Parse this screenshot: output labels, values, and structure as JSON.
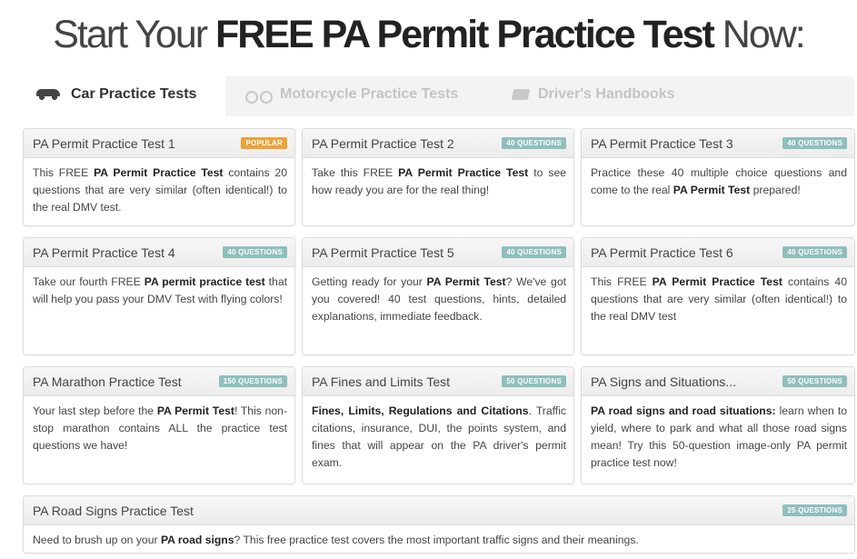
{
  "headline": {
    "prefix": "Start Your ",
    "emphasis": "FREE PA Permit Practice Test",
    "suffix": " Now:"
  },
  "tabs": [
    {
      "label": "Car Practice Tests",
      "icon": "car-icon",
      "active": true
    },
    {
      "label": "Motorcycle Practice Tests",
      "icon": "motorcycle-icon",
      "active": false
    },
    {
      "label": "Driver's Handbooks",
      "icon": "book-icon",
      "active": false
    }
  ],
  "colors": {
    "popular_badge": "#f0a23a",
    "questions_badge": "#8fbfbc"
  },
  "cards": [
    {
      "title": "PA Permit Practice Test 1",
      "badge": "POPULAR",
      "body": [
        {
          "t": "This FREE "
        },
        {
          "b": "PA Permit Practice Test"
        },
        {
          "t": " contains 20 questions that are very similar (often identical!) to the real DMV test."
        }
      ]
    },
    {
      "title": "PA Permit Practice Test 2",
      "badge": "40 QUESTIONS",
      "body": [
        {
          "t": "Take this FREE "
        },
        {
          "b": "PA Permit Practice Test"
        },
        {
          "t": " to see how ready you are for the real thing!"
        }
      ]
    },
    {
      "title": "PA Permit Practice Test 3",
      "badge": "40 QUESTIONS",
      "body": [
        {
          "t": "Practice these 40 multiple choice questions and come to the real "
        },
        {
          "b": "PA Permit Test"
        },
        {
          "t": " prepared!"
        }
      ]
    },
    {
      "title": "PA Permit Practice Test 4",
      "badge": "40 QUESTIONS",
      "body": [
        {
          "t": "Take our fourth FREE "
        },
        {
          "b": "PA permit practice test"
        },
        {
          "t": " that will help you pass your DMV Test with flying colors!"
        }
      ]
    },
    {
      "title": "PA Permit Practice Test 5",
      "badge": "40 QUESTIONS",
      "body": [
        {
          "t": "Getting ready for your "
        },
        {
          "b": "PA Permit Test"
        },
        {
          "t": "? We've got you covered! 40 test questions, hints, detailed explanations, immediate feedback."
        }
      ]
    },
    {
      "title": "PA Permit Practice Test 6",
      "badge": "40 QUESTIONS",
      "body": [
        {
          "t": "This FREE "
        },
        {
          "b": "PA Permit Practice Test"
        },
        {
          "t": " contains 40 questions that are very similar (often identical!) to the real DMV test"
        }
      ]
    },
    {
      "title": "PA Marathon Practice Test",
      "badge": "150 QUESTIONS",
      "body": [
        {
          "t": "Your last step before the "
        },
        {
          "b": "PA Permit Test"
        },
        {
          "t": "! This non-stop marathon contains ALL the practice test questions we have!"
        }
      ]
    },
    {
      "title": "PA Fines and Limits Test",
      "badge": "50 QUESTIONS",
      "body": [
        {
          "b": "Fines, Limits, Regulations and Citations"
        },
        {
          "t": ". Traffic citations, insurance, DUI, the points system, and fines that will appear on the PA driver's permit exam."
        }
      ]
    },
    {
      "title": "PA Signs and Situations...",
      "badge": "50 QUESTIONS",
      "body": [
        {
          "b": "PA road signs and road situations:"
        },
        {
          "t": " learn when to yield, where to park and what all those road signs mean! Try this 50-question image-only PA permit practice test now!"
        }
      ]
    },
    {
      "title": "PA Road Signs Practice Test",
      "badge": "25 QUESTIONS",
      "body": [
        {
          "t": "Need to brush up on your "
        },
        {
          "b": "PA road signs"
        },
        {
          "t": "? This free practice test covers the most important traffic signs and their meanings."
        }
      ]
    }
  ]
}
